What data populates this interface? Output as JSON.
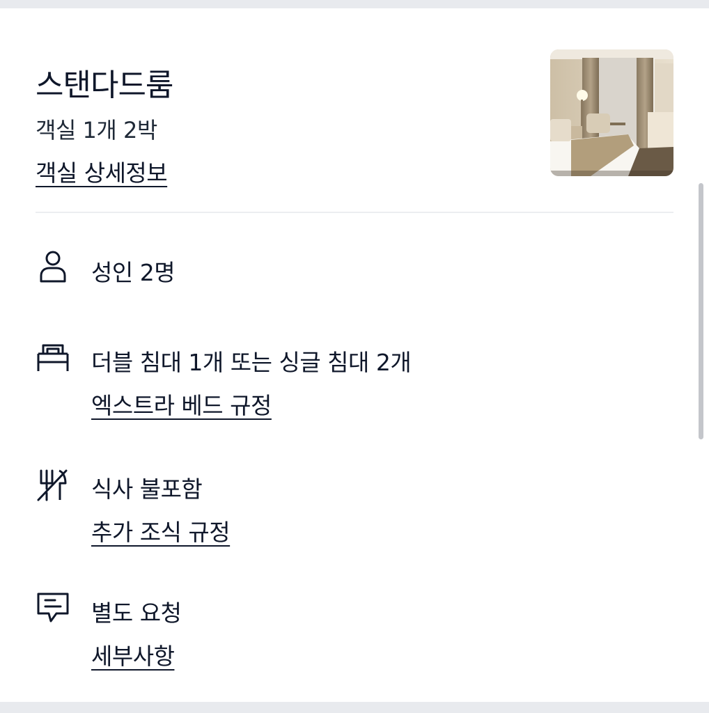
{
  "room": {
    "title": "스탠다드룸",
    "summary": "객실 1개 2박",
    "details_link": "객실 상세정보",
    "thumbnail_icon": "room-photo"
  },
  "guests": {
    "icon": "person-icon",
    "label": "성인 2명"
  },
  "bed": {
    "icon": "bed-icon",
    "label": "더블 침대 1개 또는 싱글 침대 2개",
    "link": "엑스트라 베드 규정"
  },
  "meal": {
    "icon": "no-meal-icon",
    "label": "식사 불포함",
    "link": "추가 조식 규정"
  },
  "request": {
    "icon": "message-icon",
    "label": "별도 요청",
    "link": "세부사항"
  },
  "colors": {
    "text": "#0f172a",
    "divider": "#eceef1",
    "background": "#e8eaee"
  }
}
